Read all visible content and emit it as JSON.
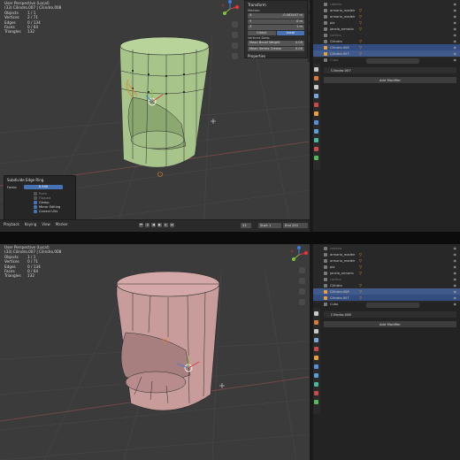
{
  "top": {
    "stats": {
      "mode": "User Perspective (Local)",
      "object": "(33) Cilindro.007 | Cilindro.008",
      "rows": [
        {
          "k": "Objects",
          "v": "1 / 1"
        },
        {
          "k": "Vertices",
          "v": "2 / 71"
        },
        {
          "k": "Edges",
          "v": "0 / 134"
        },
        {
          "k": "Faces",
          "v": "0 / 64"
        },
        {
          "k": "Triangles",
          "v": "132"
        }
      ]
    },
    "npanel": {
      "title": "Transform",
      "median_label": "Median:",
      "fields": [
        {
          "k": "X",
          "v": "-0.063447 m"
        },
        {
          "k": "Y",
          "v": "0 m"
        },
        {
          "k": "Z",
          "v": "1 m"
        }
      ],
      "buttons": [
        "Global",
        "Local"
      ],
      "data_label": "Vertices Data:",
      "data_fields": [
        {
          "k": "Mean Bevel Weight",
          "v": "0.00"
        },
        {
          "k": "Mean Vertex Crease",
          "v": "0.00"
        }
      ],
      "properties": "Properties"
    },
    "redo": {
      "title": "Subdivide Edge Ring",
      "factor_label": "Factor",
      "factor_value": "0.500",
      "checks": [
        {
          "label": "Even",
          "on": false
        },
        {
          "label": "Flipped",
          "on": false
        },
        {
          "label": "Clamp",
          "on": true
        },
        {
          "label": "Mirror Editing",
          "on": true
        },
        {
          "label": "Correct UVs",
          "on": true
        }
      ]
    },
    "timeline": {
      "menus": [
        "Playback",
        "Keying",
        "View",
        "Marker"
      ],
      "current": "33",
      "start_label": "Start",
      "start": "1",
      "end_label": "End",
      "end": "250"
    },
    "outliner": [
      {
        "name": "cadeira",
        "state": "dim"
      },
      {
        "name": "armario_madeir",
        "state": "normal"
      },
      {
        "name": "armario_madeir",
        "state": "normal"
      },
      {
        "name": "pia",
        "state": "normal"
      },
      {
        "name": "janela_armario",
        "state": "normal"
      },
      {
        "name": "cortina",
        "state": "dim"
      },
      {
        "name": "Cilindro",
        "state": "normal"
      },
      {
        "name": "Cilindro.008",
        "state": "sel"
      },
      {
        "name": "Cilindro.007",
        "state": "act"
      },
      {
        "name": "Cubo",
        "state": "dim"
      }
    ],
    "object_name": "Cilindro.007",
    "add_modifier": "Add Modifier"
  },
  "bottom": {
    "stats": {
      "mode": "User Perspective (Local)",
      "object": "(33) Cilindro.007 | Cilindro.008",
      "rows": [
        {
          "k": "Objects",
          "v": "1 / 1"
        },
        {
          "k": "Vertices",
          "v": "0 / 71"
        },
        {
          "k": "Edges",
          "v": "0 / 134"
        },
        {
          "k": "Faces",
          "v": "0 / 64"
        },
        {
          "k": "Triangles",
          "v": "132"
        }
      ]
    },
    "outliner": [
      {
        "name": "cadeira",
        "state": "dim"
      },
      {
        "name": "armario_madeir",
        "state": "normal"
      },
      {
        "name": "armario_madeir",
        "state": "normal"
      },
      {
        "name": "pia",
        "state": "normal"
      },
      {
        "name": "janela_armario",
        "state": "normal"
      },
      {
        "name": "cortina",
        "state": "dim"
      },
      {
        "name": "Cilindro",
        "state": "normal"
      },
      {
        "name": "Cilindro.008",
        "state": "act"
      },
      {
        "name": "Cilindro.007",
        "state": "sel"
      },
      {
        "name": "Cubo",
        "state": "normal"
      }
    ],
    "object_name": "Cilindro.008",
    "add_modifier": "Add Modifier"
  },
  "colors": {
    "mesh_green": "#a7c48a",
    "mesh_pink": "#c99c9c",
    "accent_blue": "#4772b3",
    "viewport_bg": "#3b3b3b"
  }
}
